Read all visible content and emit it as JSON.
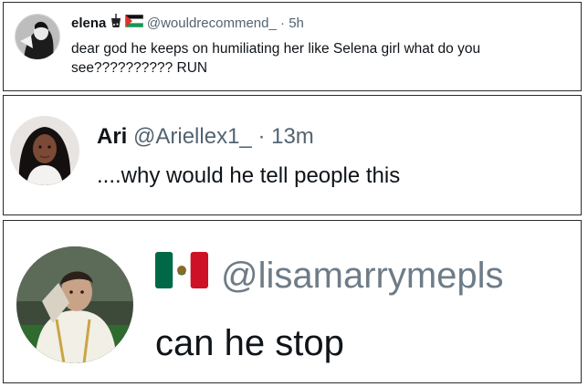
{
  "posts": [
    {
      "name": "elena",
      "emojis": [
        "bubble-tea-icon",
        "palestine-flag-icon"
      ],
      "handle": "@wouldrecommend_",
      "separator": "·",
      "time": "5h",
      "text": "dear god he keeps on humiliating her like Selena girl what do you see?????????? RUN"
    },
    {
      "name": "Ari",
      "handle": "@Ariellex1_",
      "separator": "·",
      "time": "13m",
      "text": "....why would he tell people this"
    },
    {
      "emojis": [
        "mexico-flag-icon"
      ],
      "handle": "@lisamarrymepls",
      "text": "can he stop"
    }
  ],
  "colors": {
    "text": "#0f1419",
    "muted": "#536471",
    "border": "#2b2b2b"
  }
}
